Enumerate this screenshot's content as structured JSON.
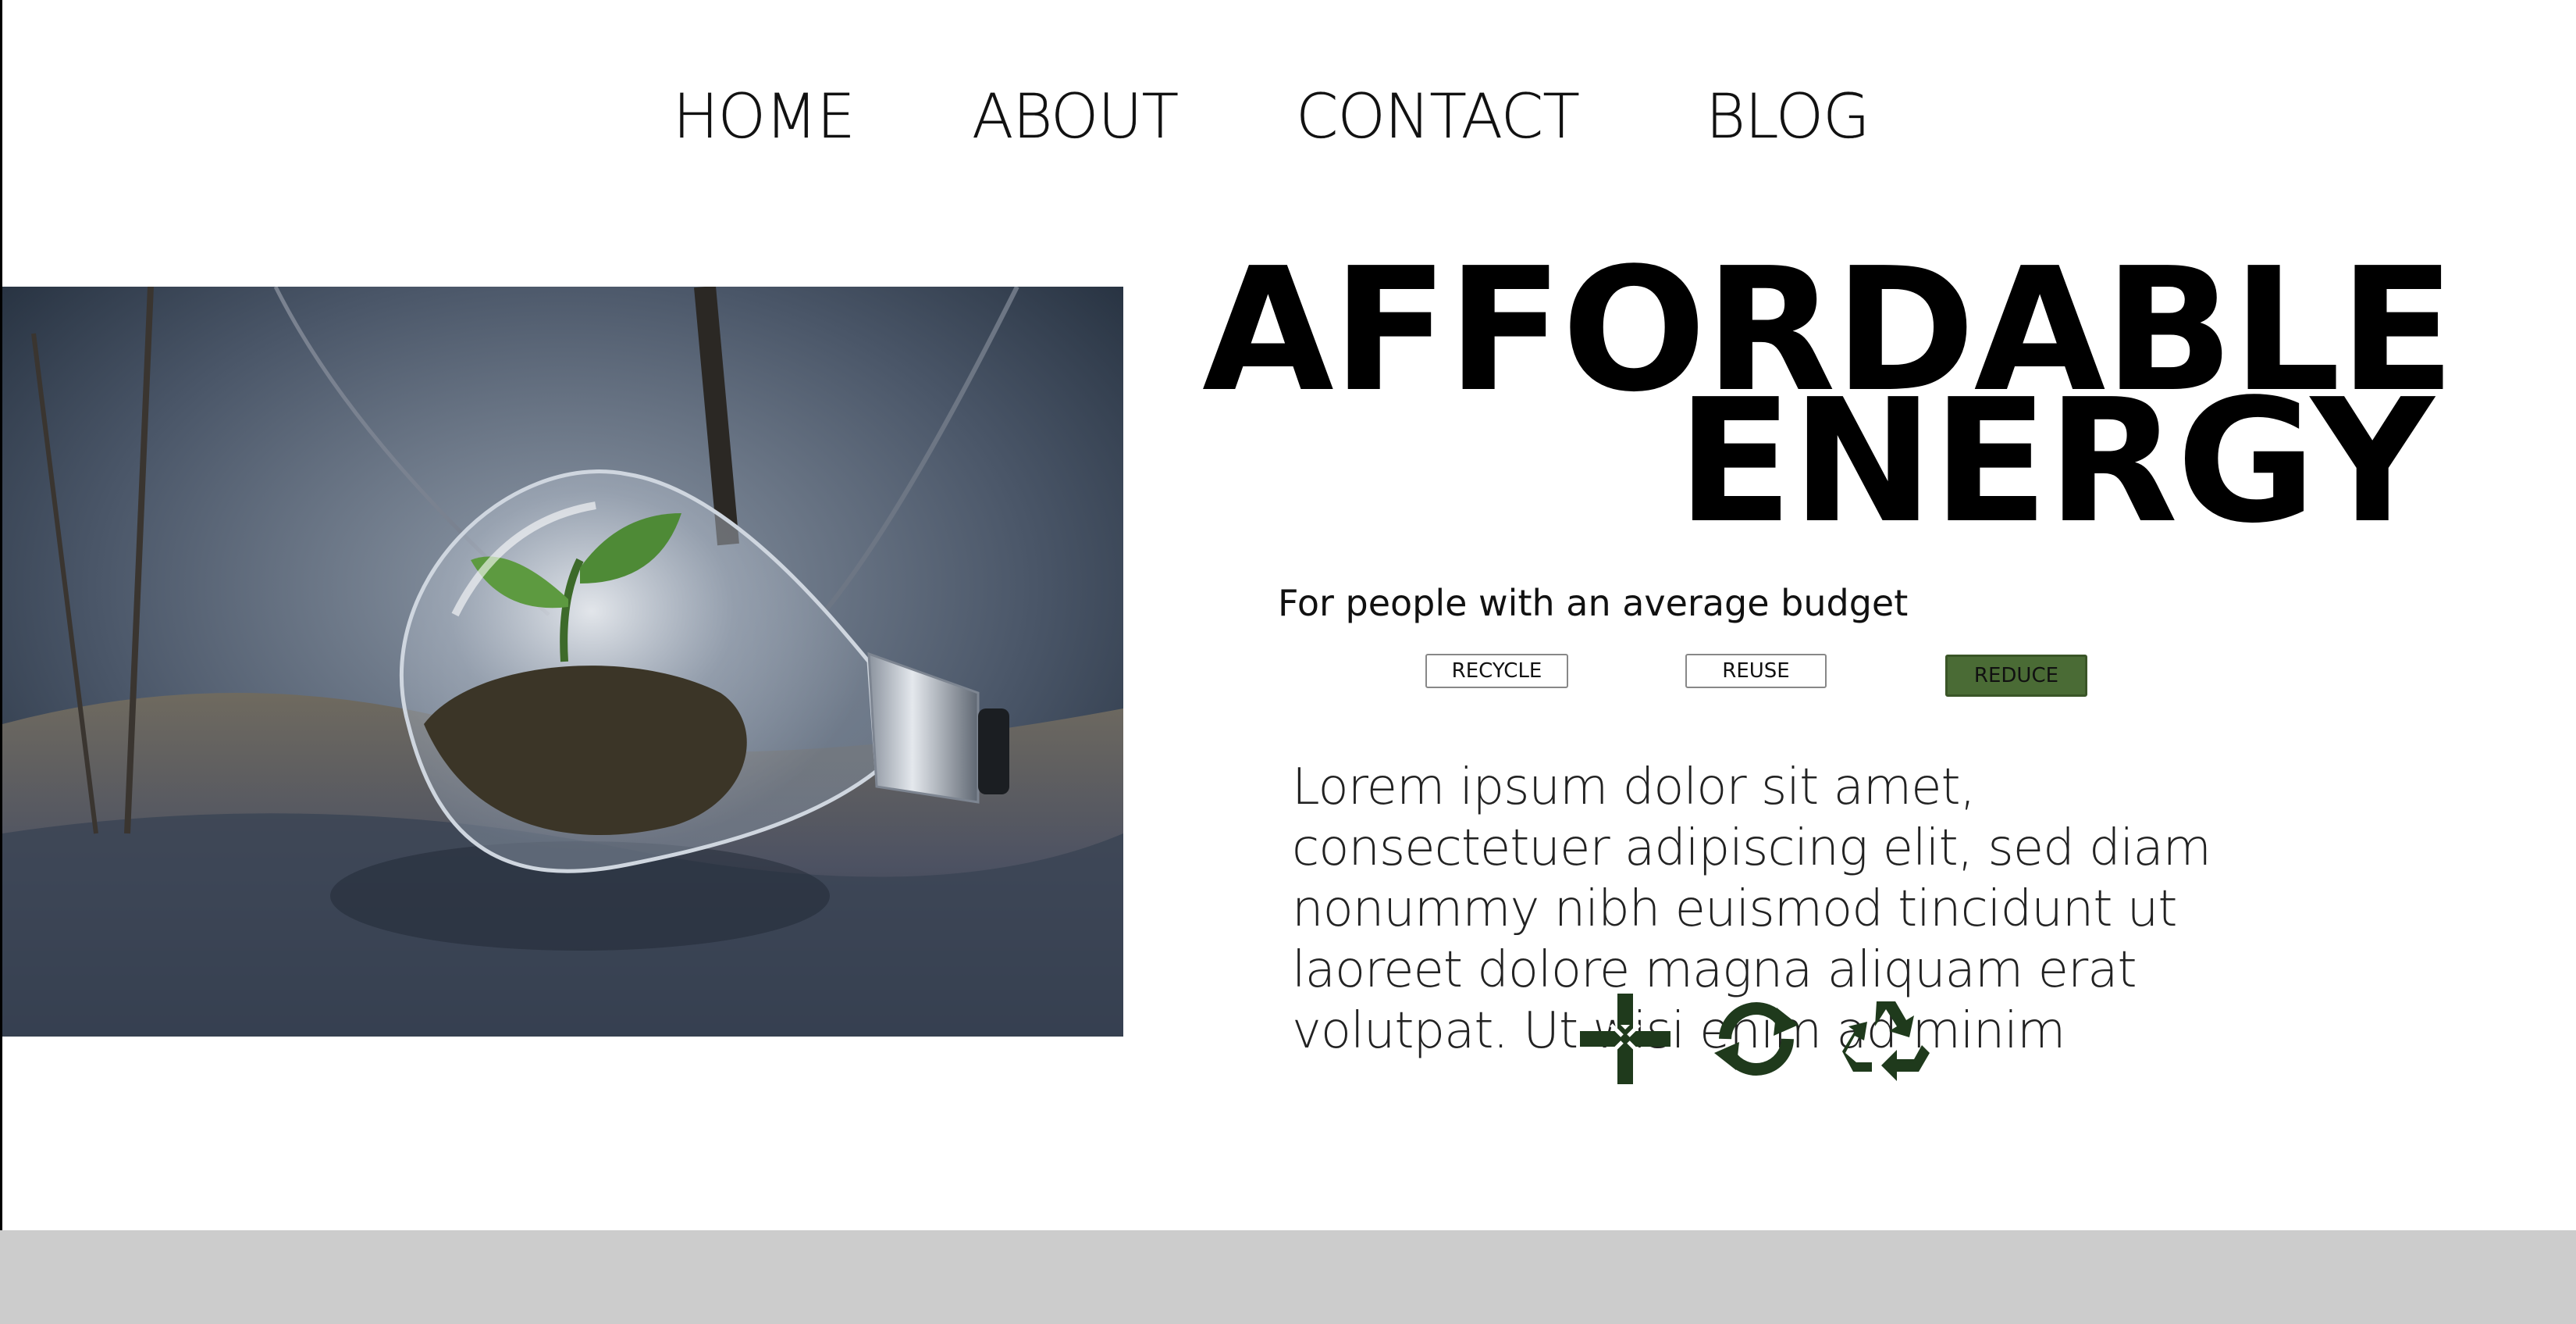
{
  "nav": {
    "items": [
      {
        "label": "HOME"
      },
      {
        "label": "ABOUT"
      },
      {
        "label": "CONTACT"
      },
      {
        "label": "BLOG"
      }
    ]
  },
  "hero": {
    "headline_line1": "AFFORDABLE",
    "headline_line2": "ENERGY",
    "subtitle": "For people with an average budget",
    "image_icon": "lightbulb-with-seedling-photo"
  },
  "buttons": {
    "recycle": "RECYCLE",
    "reuse": "REUSE",
    "reduce": "REDUCE"
  },
  "body": {
    "text": "Lorem ipsum dolor sit amet, consectetuer adipiscing elit, sed diam nonummy nibh euismod tincidunt ut laoreet dolore magna aliquam erat volutpat. Ut wisi enim ad minim"
  },
  "icons": [
    {
      "name": "reduce-icon"
    },
    {
      "name": "reuse-icon"
    },
    {
      "name": "recycle-icon"
    }
  ],
  "colors": {
    "accent_green": "#4a6b35",
    "icon_green": "#1f3a1c",
    "footer_gray": "#cccccc"
  }
}
